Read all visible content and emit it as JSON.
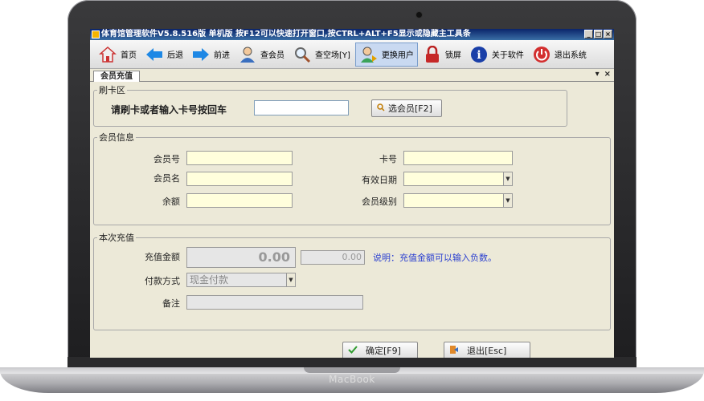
{
  "window": {
    "title": "体育馆管理软件V5.8.516版 单机版 按F12可以快速打开窗口,按CTRL+ALT+F5显示或隐藏主工具条",
    "min": "_",
    "max": "□",
    "close": "×"
  },
  "toolbar": {
    "home": "首页",
    "back": "后退",
    "forward": "前进",
    "query_member": "查会员",
    "query_venue": "查空场[Y]",
    "switch_user": "更换用户",
    "lock": "锁屏",
    "about": "关于软件",
    "exit": "退出系统"
  },
  "tab": {
    "label": "会员充值",
    "pin": "▾",
    "close": "×"
  },
  "swipe": {
    "legend": "刷卡区",
    "prompt": "请刷卡或者输入卡号按回车",
    "card_input": "",
    "select_button": "选会员[F2]"
  },
  "member": {
    "legend": "会员信息",
    "member_no_label": "会员号",
    "member_name_label": "会员名",
    "balance_label": "余额",
    "card_no_label": "卡号",
    "valid_date_label": "有效日期",
    "level_label": "会员级别"
  },
  "recharge": {
    "legend": "本次充值",
    "amount_label": "充值金额",
    "amount_value": "0.00",
    "amount_secondary": "0.00",
    "note": "说明：充值金额可以输入负数。",
    "payment_label": "付款方式",
    "payment_value": "现金付款",
    "remark_label": "备注"
  },
  "actions": {
    "confirm": "确定[F9]",
    "exit": "退出[Esc]"
  },
  "device": {
    "brand": "MacBook"
  },
  "colors": {
    "accent": "#0a246a",
    "field_bg": "#fffedc",
    "note": "#2a3fd0"
  }
}
